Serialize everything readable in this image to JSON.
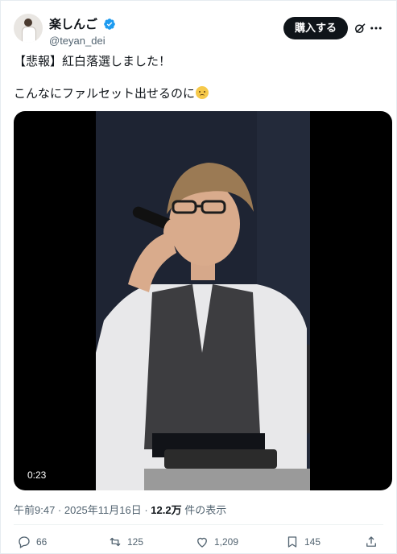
{
  "author": {
    "display_name": "楽しんご",
    "handle": "@teyan_dei",
    "verified": true
  },
  "header": {
    "buy_label": "購入する",
    "icons": [
      "grok-icon",
      "more-icon"
    ]
  },
  "tweet": {
    "line1": "【悲報】紅白落選しました！",
    "line2": "こんなにファルセット出せるのに",
    "emoji": "smiling-face-with-tear-emoji"
  },
  "media": {
    "type": "video",
    "duration": "0:23"
  },
  "meta": {
    "time": "午前9:47 · 2025年11月16日 ·",
    "views": "12.2万",
    "views_suffix": "件の表示"
  },
  "actions": {
    "replies": "66",
    "retweets": "125",
    "likes": "1,209",
    "bookmarks": "145"
  },
  "colors": {
    "text": "#0f1419",
    "secondary": "#536471",
    "verified": "#1d9bf0",
    "button": "#0f1419"
  }
}
